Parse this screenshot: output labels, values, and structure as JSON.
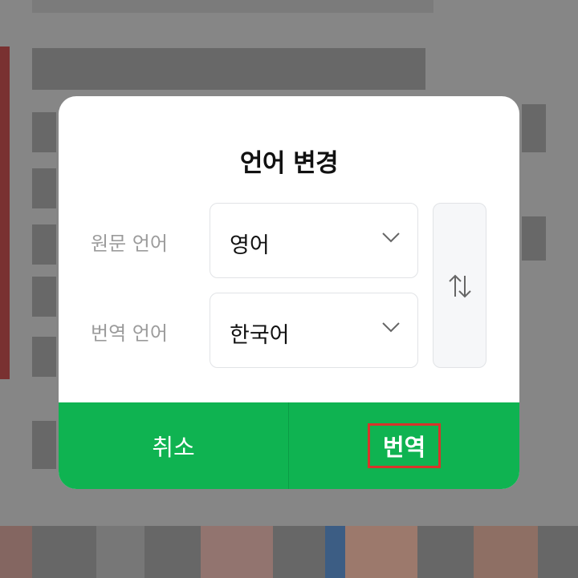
{
  "dialog": {
    "title": "언어 변경",
    "source": {
      "label": "원문 언어",
      "value": "영어"
    },
    "target": {
      "label": "번역 언어",
      "value": "한국어"
    },
    "buttons": {
      "cancel": "취소",
      "confirm": "번역"
    }
  },
  "icons": {
    "dropdown": "chevron-down-icon",
    "swap": "swap-vertical-icon"
  },
  "colors": {
    "primary": "#0fb351",
    "highlight": "#d9332a"
  }
}
